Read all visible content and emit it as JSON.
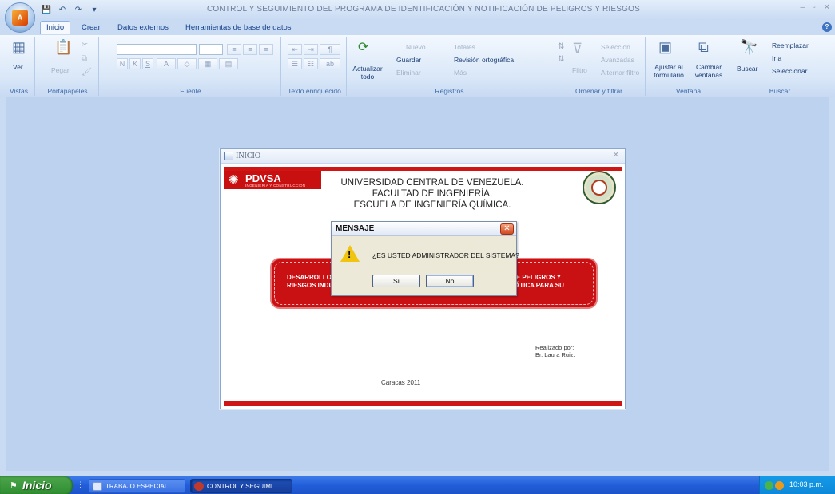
{
  "app": {
    "title": "CONTROL Y SEGUIMIENTO DEL PROGRAMA DE IDENTIFICACIÓN Y NOTIFICACIÓN DE PELIGROS Y RIESGOS",
    "window_controls": [
      "–",
      "▫",
      "✕"
    ]
  },
  "ribbon": {
    "tabs": [
      "Inicio",
      "Crear",
      "Datos externos",
      "Herramientas de base de datos"
    ],
    "active_tab": "Inicio",
    "groups": {
      "vistas": {
        "label": "Vistas",
        "button": "Ver"
      },
      "portapapeles": {
        "label": "Portapapeles",
        "button": "Pegar"
      },
      "fuente": {
        "label": "Fuente",
        "bold": "N",
        "italic": "K",
        "underline": "S",
        "font_color": "A"
      },
      "texto": {
        "label": "Texto enriquecido"
      },
      "registros": {
        "label": "Registros",
        "refresh": "Actualizar todo",
        "nuevo": "Nuevo",
        "guardar": "Guardar",
        "eliminar": "Eliminar",
        "totales": "Totales",
        "ortografia": "Revisión ortográfica",
        "mas": "Más"
      },
      "ordenar": {
        "label": "Ordenar y filtrar",
        "filtro": "Filtro",
        "seleccion": "Selección",
        "avanzadas": "Avanzadas",
        "alternar": "Alternar filtro"
      },
      "ventana": {
        "label": "Ventana",
        "ajustar": "Ajustar al formulario",
        "cambiar": "Cambiar ventanas"
      },
      "buscar": {
        "label": "Buscar",
        "buscar": "Buscar",
        "reemplazar": "Reemplazar",
        "ira": "Ir a",
        "seleccionar": "Seleccionar"
      }
    }
  },
  "form": {
    "title": "INICIO",
    "logo": "PDVSA",
    "logo_sub": "INGENIERÍA Y CONSTRUCCIÓN",
    "university": [
      "UNIVERSIDAD CENTRAL DE VENEZUELA.",
      "FACULTAD DE INGENIERÍA.",
      "ESCUELA DE INGENIERÍA QUÍMICA."
    ],
    "banner_left": [
      "DESARROLLO",
      "RIESGOS INDU"
    ],
    "banner_right": [
      "N DE PELIGROS Y",
      "RMÁTICA PARA SU"
    ],
    "realizado": [
      "Realizado por:",
      "Br. Laura Ruiz."
    ],
    "place": "Caracas 2011"
  },
  "dialog": {
    "title": "MENSAJE",
    "message": "¿ES USTED ADMINISTRADOR DEL SISTEMA?",
    "yes": "Sí",
    "no": "No",
    "icon": "warning-icon"
  },
  "taskbar": {
    "start": "Inicio",
    "items": [
      "TRABAJO ESPECIAL ...",
      "CONTROL Y SEGUIMI..."
    ],
    "clock": "10:03 p.m."
  }
}
